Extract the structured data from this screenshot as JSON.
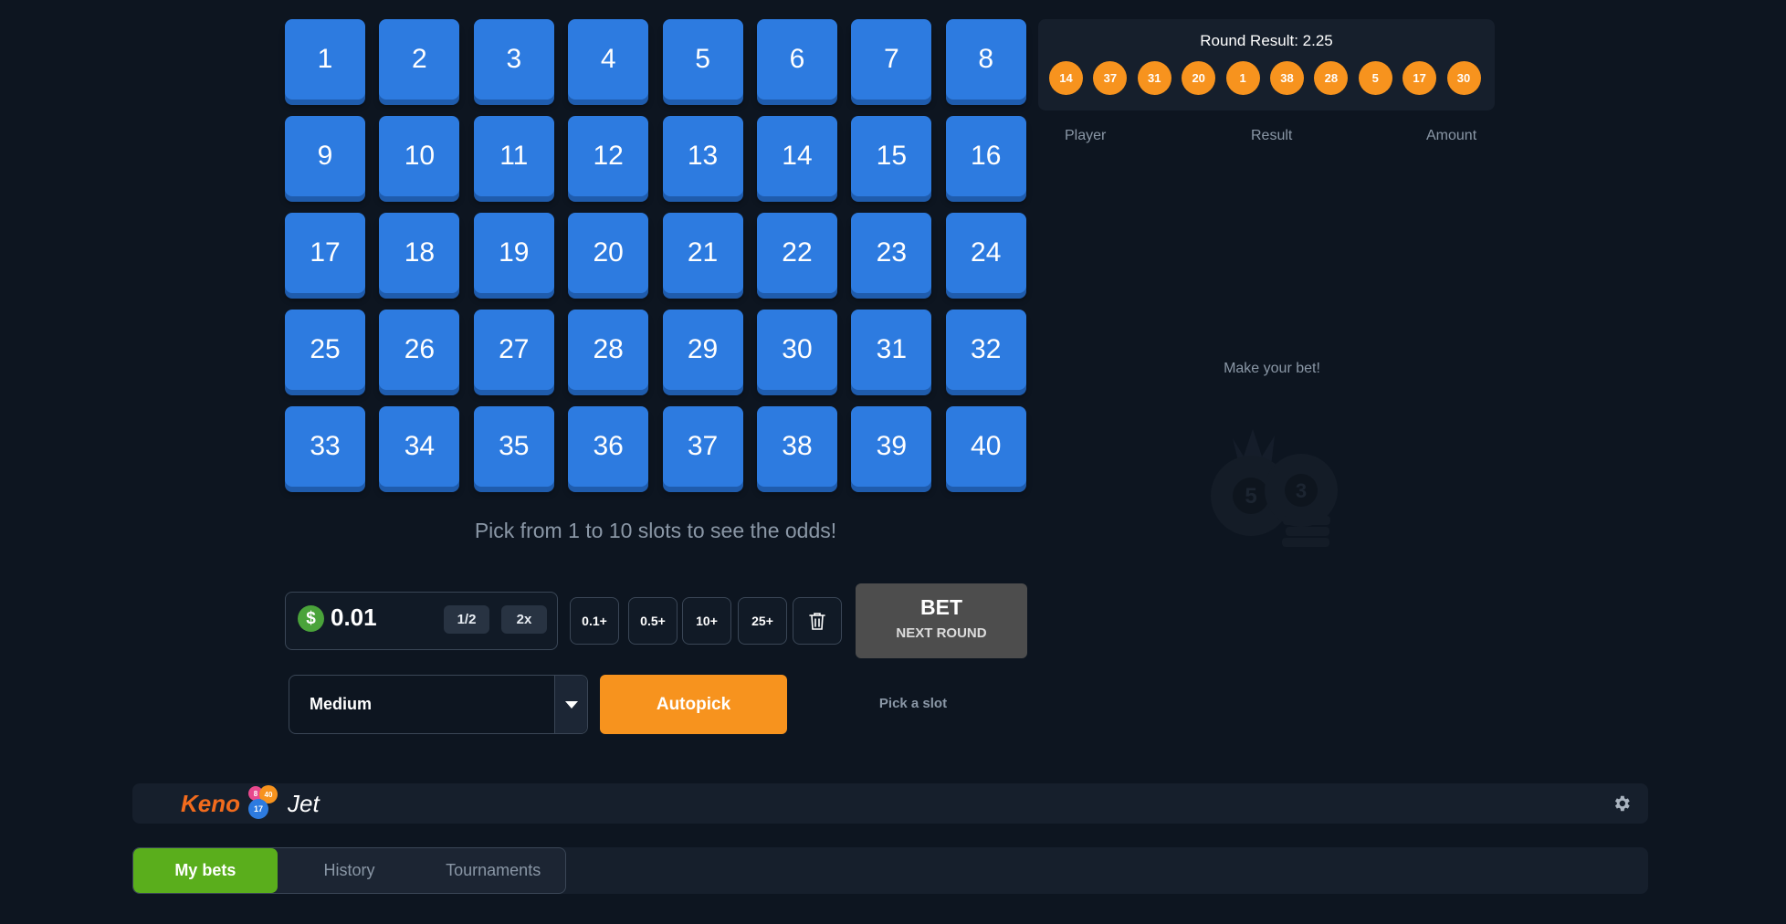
{
  "grid": {
    "numbers": [
      "1",
      "2",
      "3",
      "4",
      "5",
      "6",
      "7",
      "8",
      "9",
      "10",
      "11",
      "12",
      "13",
      "14",
      "15",
      "16",
      "17",
      "18",
      "19",
      "20",
      "21",
      "22",
      "23",
      "24",
      "25",
      "26",
      "27",
      "28",
      "29",
      "30",
      "31",
      "32",
      "33",
      "34",
      "35",
      "36",
      "37",
      "38",
      "39",
      "40"
    ]
  },
  "hint": "Pick from 1 to 10 slots to see the odds!",
  "bet": {
    "currency_icon": "$",
    "amount": "0.01",
    "half_label": "1/2",
    "double_label": "2x",
    "quick_amounts": [
      "0.1+",
      "0.5+",
      "10+",
      "25+"
    ],
    "clear_icon": "trash-icon",
    "button_label": "BET",
    "button_sub": "NEXT ROUND"
  },
  "risk": {
    "value": "Medium"
  },
  "autopick_label": "Autopick",
  "pick_slot_text": "Pick a slot",
  "result": {
    "title": "Round Result: 2.25",
    "balls": [
      "14",
      "37",
      "31",
      "20",
      "1",
      "38",
      "28",
      "5",
      "17",
      "30"
    ]
  },
  "bets_table": {
    "headers": [
      "Player",
      "Result",
      "Amount"
    ],
    "empty_text": "Make your bet!"
  },
  "logo": {
    "left": "Keno",
    "right": "Jet",
    "ball_numbers": [
      "8",
      "40",
      "17"
    ]
  },
  "tabs": [
    {
      "label": "My bets",
      "active": true
    },
    {
      "label": "History",
      "active": false
    },
    {
      "label": "Tournaments",
      "active": false
    }
  ],
  "colors": {
    "background": "#0d1520",
    "tile": "#2d7be0",
    "orange": "#f7931e",
    "green": "#5aae1c",
    "bet_button": "#4d4d4d"
  }
}
